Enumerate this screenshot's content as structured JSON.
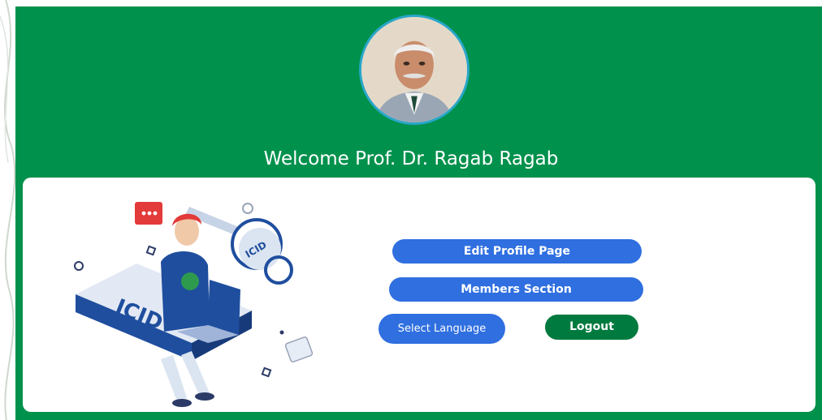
{
  "user": {
    "welcome_text": "Welcome Prof. Dr. Ragab Ragab"
  },
  "actions": {
    "edit_profile_label": "Edit Profile Page",
    "members_label": "Members Section",
    "language_label": "Select Language",
    "logout_label": "Logout"
  },
  "illustration": {
    "device_text": "ICID",
    "key_text": "ICID"
  },
  "colors": {
    "brand_green": "#00914c",
    "button_blue": "#2f6fe0",
    "logout_green": "#007a3f"
  },
  "icons": [
    "profile-photo",
    "chat-bubble-icon",
    "key-icon",
    "laptop-icon",
    "phone-icon"
  ]
}
